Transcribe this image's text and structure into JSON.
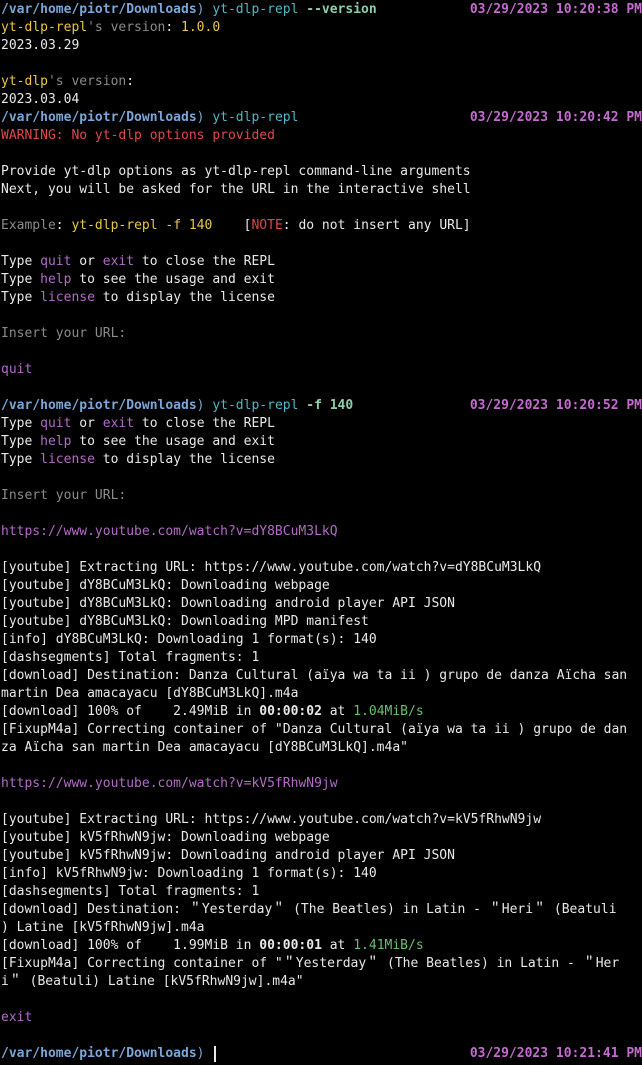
{
  "terminal": {
    "lines": [
      {
        "type": "prompt",
        "path": "/var/home/piotr/Downloads",
        "sep": ")",
        "cmd": "yt-dlp-repl",
        "args": "--version",
        "time": "03/29/2023 10:20:38 PM"
      },
      {
        "type": "text",
        "segments": [
          {
            "t": "yt-dlp-repl",
            "c": "yellow"
          },
          {
            "t": "'s version",
            "c": "gray"
          },
          {
            "t": ": ",
            "c": "white"
          },
          {
            "t": "1.0.0",
            "c": "yellow"
          }
        ]
      },
      {
        "type": "text",
        "segments": [
          {
            "t": "2023.03.29",
            "c": "white"
          }
        ]
      },
      {
        "type": "blank"
      },
      {
        "type": "text",
        "segments": [
          {
            "t": "yt-dlp",
            "c": "yellow"
          },
          {
            "t": "'s version",
            "c": "gray"
          },
          {
            "t": ":",
            "c": "white"
          }
        ]
      },
      {
        "type": "text",
        "segments": [
          {
            "t": "2023.03.04",
            "c": "white"
          }
        ]
      },
      {
        "type": "prompt",
        "path": "/var/home/piotr/Downloads",
        "sep": ")",
        "cmd": "yt-dlp-repl",
        "args": "",
        "time": "03/29/2023 10:20:42 PM"
      },
      {
        "type": "text",
        "segments": [
          {
            "t": "WARNING: No yt-dlp options provided",
            "c": "red"
          }
        ]
      },
      {
        "type": "blank"
      },
      {
        "type": "text",
        "segments": [
          {
            "t": "Provide yt-dlp options as yt-dlp-repl command-line arguments",
            "c": "white"
          }
        ]
      },
      {
        "type": "text",
        "segments": [
          {
            "t": "Next, you will be asked for the URL in the interactive shell",
            "c": "white"
          }
        ]
      },
      {
        "type": "blank"
      },
      {
        "type": "text",
        "segments": [
          {
            "t": "Example",
            "c": "gray"
          },
          {
            "t": ": ",
            "c": "white"
          },
          {
            "t": "yt-dlp-repl -f 140",
            "c": "yellow"
          },
          {
            "t": "    [",
            "c": "white"
          },
          {
            "t": "NOTE",
            "c": "red"
          },
          {
            "t": ": do not insert any URL]",
            "c": "white"
          }
        ]
      },
      {
        "type": "blank"
      },
      {
        "type": "text",
        "segments": [
          {
            "t": "Type ",
            "c": "white"
          },
          {
            "t": "quit",
            "c": "purple"
          },
          {
            "t": " or ",
            "c": "white"
          },
          {
            "t": "exit",
            "c": "purple"
          },
          {
            "t": " to close the REPL",
            "c": "white"
          }
        ]
      },
      {
        "type": "text",
        "segments": [
          {
            "t": "Type ",
            "c": "white"
          },
          {
            "t": "help",
            "c": "purple"
          },
          {
            "t": " to see the usage and exit",
            "c": "white"
          }
        ]
      },
      {
        "type": "text",
        "segments": [
          {
            "t": "Type ",
            "c": "white"
          },
          {
            "t": "license",
            "c": "purple"
          },
          {
            "t": " to display the license",
            "c": "white"
          }
        ]
      },
      {
        "type": "blank"
      },
      {
        "type": "text",
        "segments": [
          {
            "t": "Insert your URL:",
            "c": "gray"
          }
        ]
      },
      {
        "type": "blank"
      },
      {
        "type": "text",
        "segments": [
          {
            "t": "quit",
            "c": "purple"
          }
        ]
      },
      {
        "type": "blank"
      },
      {
        "type": "prompt",
        "path": "/var/home/piotr/Downloads",
        "sep": ")",
        "cmd": "yt-dlp-repl",
        "args": "-f 140",
        "time": "03/29/2023 10:20:52 PM"
      },
      {
        "type": "text",
        "segments": [
          {
            "t": "Type ",
            "c": "white"
          },
          {
            "t": "quit",
            "c": "purple"
          },
          {
            "t": " or ",
            "c": "white"
          },
          {
            "t": "exit",
            "c": "purple"
          },
          {
            "t": " to close the REPL",
            "c": "white"
          }
        ]
      },
      {
        "type": "text",
        "segments": [
          {
            "t": "Type ",
            "c": "white"
          },
          {
            "t": "help",
            "c": "purple"
          },
          {
            "t": " to see the usage and exit",
            "c": "white"
          }
        ]
      },
      {
        "type": "text",
        "segments": [
          {
            "t": "Type ",
            "c": "white"
          },
          {
            "t": "license",
            "c": "purple"
          },
          {
            "t": " to display the license",
            "c": "white"
          }
        ]
      },
      {
        "type": "blank"
      },
      {
        "type": "text",
        "segments": [
          {
            "t": "Insert your URL:",
            "c": "gray"
          }
        ]
      },
      {
        "type": "blank"
      },
      {
        "type": "text",
        "segments": [
          {
            "t": "https://www.youtube.com/watch?v=dY8BCuM3LkQ",
            "c": "purple"
          }
        ]
      },
      {
        "type": "blank"
      },
      {
        "type": "text",
        "segments": [
          {
            "t": "[youtube] Extracting URL: https://www.youtube.com/watch?v=dY8BCuM3LkQ",
            "c": "white"
          }
        ]
      },
      {
        "type": "text",
        "segments": [
          {
            "t": "[youtube] dY8BCuM3LkQ: Downloading webpage",
            "c": "white"
          }
        ]
      },
      {
        "type": "text",
        "segments": [
          {
            "t": "[youtube] dY8BCuM3LkQ: Downloading android player API JSON",
            "c": "white"
          }
        ]
      },
      {
        "type": "text",
        "segments": [
          {
            "t": "[youtube] dY8BCuM3LkQ: Downloading MPD manifest",
            "c": "white"
          }
        ]
      },
      {
        "type": "text",
        "segments": [
          {
            "t": "[info] dY8BCuM3LkQ: Downloading 1 format(s): 140",
            "c": "white"
          }
        ]
      },
      {
        "type": "text",
        "segments": [
          {
            "t": "[dashsegments] Total fragments: 1",
            "c": "white"
          }
        ]
      },
      {
        "type": "text",
        "segments": [
          {
            "t": "[download] Destination: Danza Cultural (aïya wa ta ii ) grupo de danza Aïcha san",
            "c": "white"
          }
        ]
      },
      {
        "type": "text",
        "segments": [
          {
            "t": "martin Dea amacayacu [dY8BCuM3LkQ].m4a",
            "c": "white"
          }
        ]
      },
      {
        "type": "text",
        "segments": [
          {
            "t": "[download] 100% of    2.49MiB in ",
            "c": "white"
          },
          {
            "t": "00:00:02",
            "c": "white",
            "b": true
          },
          {
            "t": " at ",
            "c": "white"
          },
          {
            "t": "1.04MiB/s",
            "c": "green"
          }
        ]
      },
      {
        "type": "text",
        "segments": [
          {
            "t": "[FixupM4a] Correcting container of \"Danza Cultural (aïya wa ta ii ) grupo de dan",
            "c": "white"
          }
        ]
      },
      {
        "type": "text",
        "segments": [
          {
            "t": "za Aïcha san martin Dea amacayacu [dY8BCuM3LkQ].m4a\"",
            "c": "white"
          }
        ]
      },
      {
        "type": "blank"
      },
      {
        "type": "text",
        "segments": [
          {
            "t": "https://www.youtube.com/watch?v=kV5fRhwN9jw",
            "c": "purple"
          }
        ]
      },
      {
        "type": "blank"
      },
      {
        "type": "text",
        "segments": [
          {
            "t": "[youtube] Extracting URL: https://www.youtube.com/watch?v=kV5fRhwN9jw",
            "c": "white"
          }
        ]
      },
      {
        "type": "text",
        "segments": [
          {
            "t": "[youtube] kV5fRhwN9jw: Downloading webpage",
            "c": "white"
          }
        ]
      },
      {
        "type": "text",
        "segments": [
          {
            "t": "[youtube] kV5fRhwN9jw: Downloading android player API JSON",
            "c": "white"
          }
        ]
      },
      {
        "type": "text",
        "segments": [
          {
            "t": "[info] kV5fRhwN9jw: Downloading 1 format(s): 140",
            "c": "white"
          }
        ]
      },
      {
        "type": "text",
        "segments": [
          {
            "t": "[dashsegments] Total fragments: 1",
            "c": "white"
          }
        ]
      },
      {
        "type": "text",
        "segments": [
          {
            "t": "[download] Destination: ＂Yesterday＂ (The Beatles) in Latin - ＂Heri＂ (Beatuli",
            "c": "white"
          }
        ]
      },
      {
        "type": "text",
        "segments": [
          {
            "t": ") Latine [kV5fRhwN9jw].m4a",
            "c": "white"
          }
        ]
      },
      {
        "type": "text",
        "segments": [
          {
            "t": "[download] 100% of    1.99MiB in ",
            "c": "white"
          },
          {
            "t": "00:00:01",
            "c": "white",
            "b": true
          },
          {
            "t": " at ",
            "c": "white"
          },
          {
            "t": "1.41MiB/s",
            "c": "green"
          }
        ]
      },
      {
        "type": "text",
        "segments": [
          {
            "t": "[FixupM4a] Correcting container of \"＂Yesterday＂ (The Beatles) in Latin - ＂Her",
            "c": "white"
          }
        ]
      },
      {
        "type": "text",
        "segments": [
          {
            "t": "i＂ (Beatuli) Latine [kV5fRhwN9jw].m4a\"",
            "c": "white"
          }
        ]
      },
      {
        "type": "blank"
      },
      {
        "type": "text",
        "segments": [
          {
            "t": "exit",
            "c": "purple"
          }
        ]
      },
      {
        "type": "blank"
      },
      {
        "type": "prompt",
        "path": "/var/home/piotr/Downloads",
        "sep": ")",
        "cmd": "",
        "args": "",
        "time": "03/29/2023 10:21:41 PM",
        "cursor": true
      }
    ]
  },
  "colors": {
    "background": "#000000",
    "foreground": "#e8e8e8",
    "prompt_path": "#7aa7d8",
    "prompt_command": "#4fb8c6",
    "prompt_time": "#c56ad1",
    "warning": "#e0474c",
    "highlight": "#e9c744",
    "keyword": "#b26bc6",
    "speed": "#67c06b"
  }
}
